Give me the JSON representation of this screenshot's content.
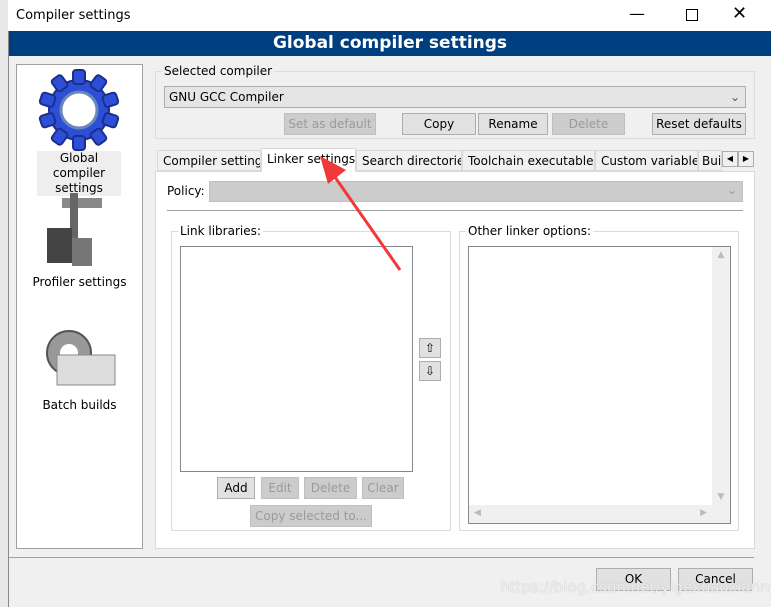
{
  "window": {
    "title": "Compiler settings",
    "header": "Global compiler settings"
  },
  "sidebar": {
    "items": [
      {
        "label": "Global compiler settings",
        "icon": "gear-icon"
      },
      {
        "label": "Profiler settings",
        "icon": "caliper-icon"
      },
      {
        "label": "Batch builds",
        "icon": "batch-gear-icon"
      }
    ]
  },
  "selected_compiler": {
    "label": "Selected compiler",
    "value": "GNU GCC Compiler",
    "buttons": {
      "set_default": "Set as default",
      "copy": "Copy",
      "rename": "Rename",
      "delete": "Delete",
      "reset": "Reset defaults"
    }
  },
  "tabs": [
    "Compiler settings",
    "Linker settings",
    "Search directories",
    "Toolchain executables",
    "Custom variables",
    "Bui"
  ],
  "linker": {
    "policy_label": "Policy:",
    "link_libraries_label": "Link libraries:",
    "other_options_label": "Other linker options:",
    "buttons": {
      "add": "Add",
      "edit": "Edit",
      "delete": "Delete",
      "clear": "Clear",
      "copy_selected": "Copy selected to..."
    }
  },
  "footer": {
    "ok": "OK",
    "cancel": "Cancel"
  },
  "watermark": "https://blog.csdn.net/yigexuaoxianny",
  "colors": {
    "header": "#003f7f",
    "arrow": "#f03a3a"
  }
}
